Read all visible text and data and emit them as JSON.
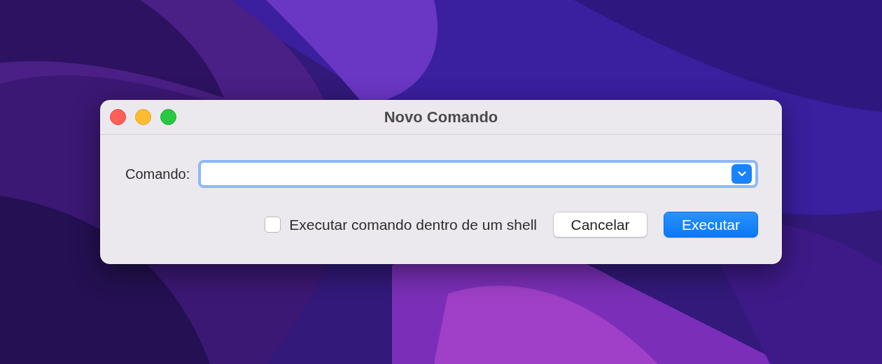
{
  "window": {
    "title": "Novo Comando"
  },
  "command": {
    "label": "Comando:",
    "focused": true
  },
  "shell_option": {
    "label": "Executar comando dentro de um shell",
    "checked": false
  },
  "buttons": [
    {
      "label": "Cancelar",
      "kind": "secondary"
    },
    {
      "label": "Executar",
      "kind": "default"
    }
  ]
}
